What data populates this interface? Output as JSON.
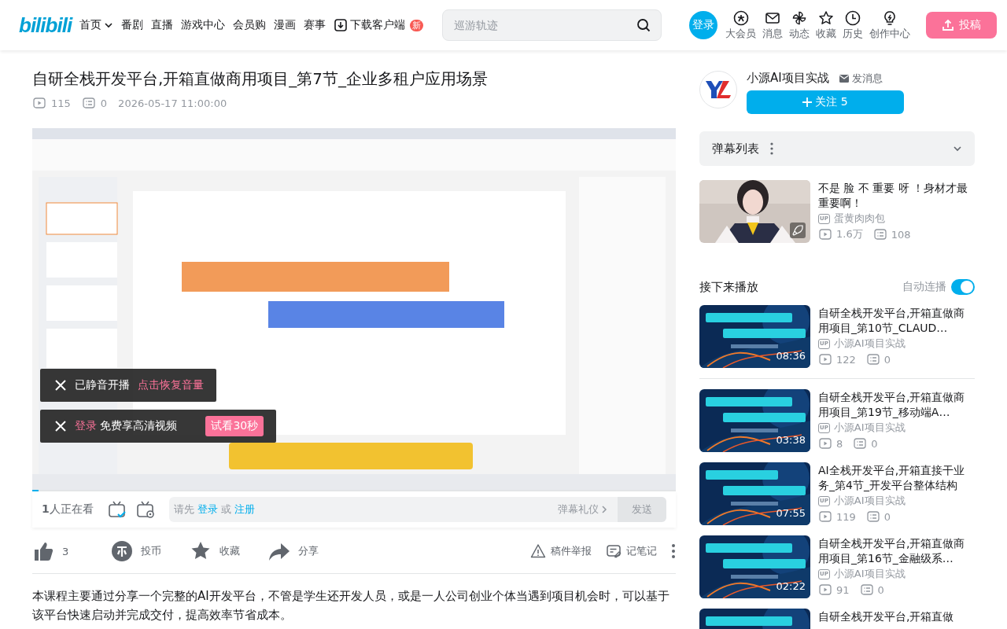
{
  "header": {
    "logo": "bilibili",
    "nav": [
      {
        "label": "首页",
        "kind": "dropdown"
      },
      {
        "label": "番剧",
        "kind": "link"
      },
      {
        "label": "直播",
        "kind": "link"
      },
      {
        "label": "游戏中心",
        "kind": "link"
      },
      {
        "label": "会员购",
        "kind": "link"
      },
      {
        "label": "漫画",
        "kind": "link"
      },
      {
        "label": "赛事",
        "kind": "link"
      },
      {
        "label": "下载客户端",
        "kind": "download",
        "badge": "新"
      }
    ],
    "search": {
      "placeholder": "巡游轨迹"
    },
    "login": "登录",
    "actions": [
      {
        "label": "大会员",
        "kind": "vip"
      },
      {
        "label": "消息",
        "kind": "mail"
      },
      {
        "label": "动态",
        "kind": "pinwheel"
      },
      {
        "label": "收藏",
        "kind": "star"
      },
      {
        "label": "历史",
        "kind": "clock"
      },
      {
        "label": "创作中心",
        "kind": "bulb"
      }
    ],
    "upload": "投稿"
  },
  "video": {
    "title": "自研全栈开发平台,开箱直做商用项目_第7节_企业多租户应用场景",
    "plays": "115",
    "danmaku": "0",
    "date": "2026-05-17 11:00:00"
  },
  "player": {
    "notices": [
      {
        "kind": "muted",
        "text": "已静音开播",
        "action": "点击恢复音量"
      },
      {
        "kind": "login",
        "link": "登录",
        "text": "免费享高清视频",
        "action": "试看30秒"
      }
    ],
    "level": 0.01
  },
  "danmaku_bar": {
    "viewers": "**1**人正在看",
    "prompt": "请先",
    "login": "登录",
    "or": "或",
    "register": "注册",
    "etiquette": "弹幕礼仪",
    "send": "发送"
  },
  "toolbar": {
    "like": "3",
    "coin": "投币",
    "favorite": "收藏",
    "share": "分享",
    "report": "稿件举报",
    "notes": "记笔记"
  },
  "description": "本课程主要通过分享一个完整的AI开发平台，不管是学生还开发人员，或是一人公司创业个体当遇到项目机会时，可以基于该平台快速启动并完成交付，提高效率节省成本。",
  "uploader": {
    "name": "小源AI项目实战",
    "message": "发消息",
    "follow": "关注 5"
  },
  "danmaku_list": {
    "title": "弹幕列表",
    "expanded": false
  },
  "ad": {
    "title": "不是 脸 不 重要 呀 ！身材才最重要啊！",
    "badge": "UP",
    "author": "蛋黄肉肉包",
    "plays": "1.6万",
    "danmaku": "108"
  },
  "up_next": {
    "title": "接下来播放",
    "autoplay_label": "自动连播",
    "autoplay": true,
    "videos": [
      {
        "title": "自研全栈开发平台,开箱直做商用项目_第10节_CLAUD…",
        "badge": "UP",
        "author": "小源AI项目实战",
        "plays": "122",
        "danmaku": "0",
        "duration": "08:36"
      },
      {
        "title": "自研全栈开发平台,开箱直做商用项目_第19节_移动端A…",
        "badge": "UP",
        "author": "小源AI项目实战",
        "plays": "8",
        "danmaku": "0",
        "duration": "03:38"
      },
      {
        "title": "AI全栈开发平台,开箱直接干业务_第4节_开发平台整体结构",
        "badge": "UP",
        "author": "小源AI项目实战",
        "plays": "119",
        "danmaku": "0",
        "duration": "07:55"
      },
      {
        "title": "自研全栈开发平台,开箱直做商用项目_第16节_金融级系…",
        "badge": "UP",
        "author": "小源AI项目实战",
        "plays": "91",
        "danmaku": "0",
        "duration": "02:22"
      },
      {
        "title": "自研全栈开发平台,开箱直做"
      }
    ]
  }
}
